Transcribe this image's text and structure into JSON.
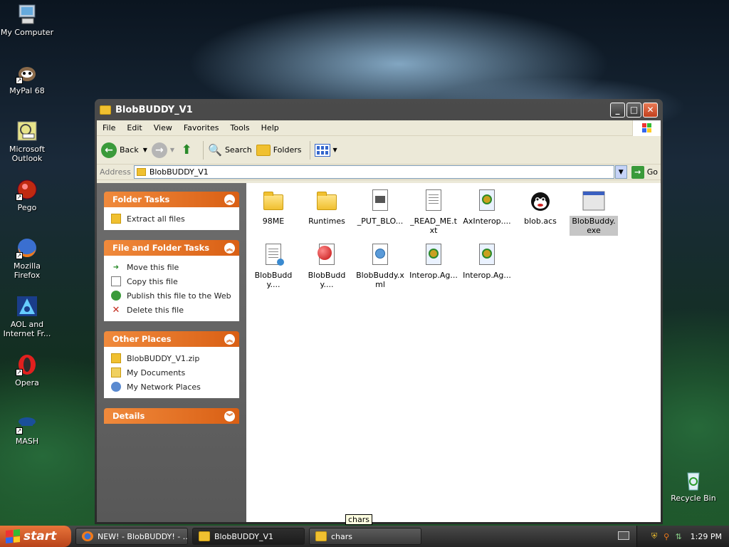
{
  "desktop": {
    "icons": [
      {
        "label": "My Computer"
      },
      {
        "label": "MyPal 68"
      },
      {
        "label": "Microsoft Outlook"
      },
      {
        "label": "Pego"
      },
      {
        "label": "Mozilla Firefox"
      },
      {
        "label": "AOL and Internet Fr..."
      },
      {
        "label": "Opera"
      },
      {
        "label": "MASH"
      },
      {
        "label": "Recycle Bin"
      }
    ]
  },
  "window": {
    "title": "BlobBUDDY_V1",
    "menu": [
      "File",
      "Edit",
      "View",
      "Favorites",
      "Tools",
      "Help"
    ],
    "toolbar": {
      "back": "Back",
      "search": "Search",
      "folders": "Folders"
    },
    "address": {
      "label": "Address",
      "value": "BlobBUDDY_V1",
      "go": "Go"
    },
    "taskpane": {
      "folder_tasks": {
        "title": "Folder Tasks",
        "items": [
          "Extract all files"
        ]
      },
      "file_folder_tasks": {
        "title": "File and Folder Tasks",
        "items": [
          "Move this file",
          "Copy this file",
          "Publish this file to the Web",
          "Delete this file"
        ]
      },
      "other_places": {
        "title": "Other Places",
        "items": [
          "BlobBUDDY_V1.zip",
          "My Documents",
          "My Network Places"
        ]
      },
      "details": {
        "title": "Details"
      }
    },
    "files": [
      {
        "name": "98ME",
        "type": "folder"
      },
      {
        "name": "Runtimes",
        "type": "folder"
      },
      {
        "name": "_PUT_BLO...",
        "type": "doc"
      },
      {
        "name": "_READ_ME.txt",
        "type": "txt"
      },
      {
        "name": "AxInterop....",
        "type": "dll"
      },
      {
        "name": "blob.acs",
        "type": "acs"
      },
      {
        "name": "BlobBuddy.exe",
        "type": "exe"
      },
      {
        "name": "BlobBuddy....",
        "type": "manifest"
      },
      {
        "name": "BlobBuddy....",
        "type": "red"
      },
      {
        "name": "BlobBuddy.xml",
        "type": "xml"
      },
      {
        "name": "Interop.Ag...",
        "type": "dll"
      },
      {
        "name": "Interop.Ag...",
        "type": "dll"
      }
    ]
  },
  "tooltip": "chars",
  "taskbar": {
    "start": "start",
    "tasks": [
      "NEW! - BlobBUDDY! - ...",
      "BlobBUDDY_V1",
      "chars"
    ],
    "clock": "1:29 PM"
  },
  "colors": {
    "accent_orange": "#d95f14",
    "selection_gray": "#c6c6c6"
  }
}
